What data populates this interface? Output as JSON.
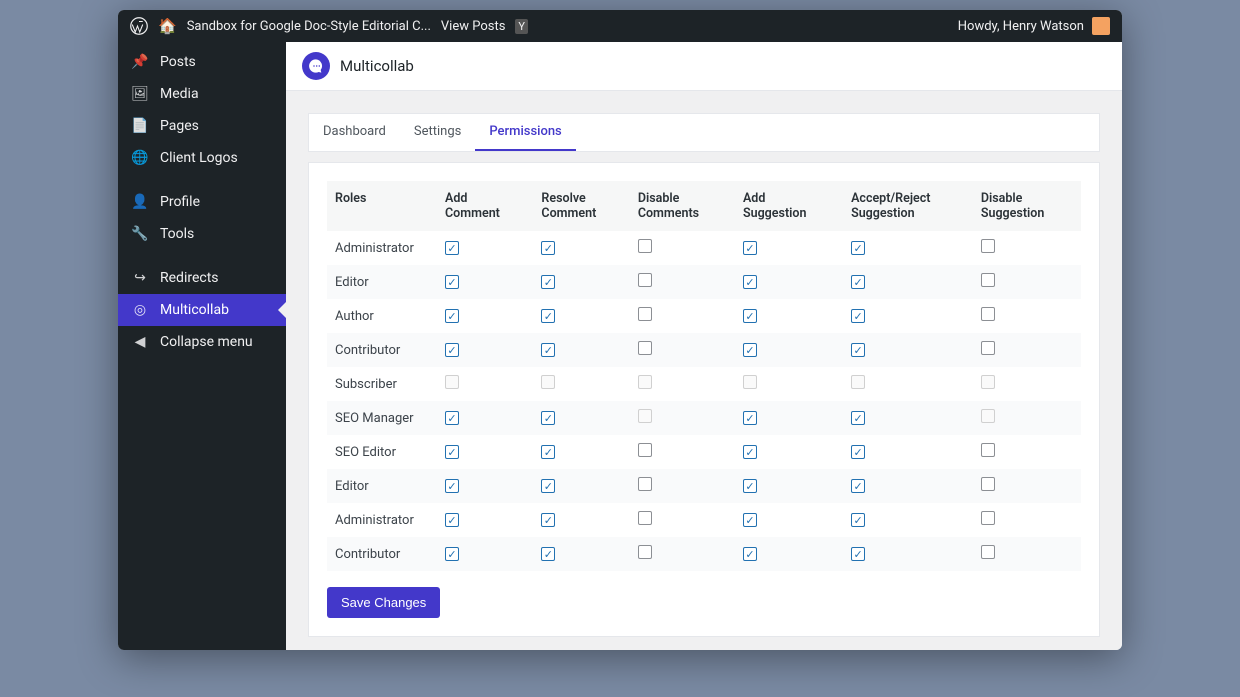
{
  "adminBar": {
    "siteName": "Sandbox for Google Doc-Style Editorial C...",
    "viewPosts": "View Posts",
    "howdy": "Howdy, Henry Watson"
  },
  "sidebar": {
    "items": [
      {
        "icon": "📌",
        "label": "Posts",
        "name": "sidebar-item-posts"
      },
      {
        "icon": "🖼",
        "label": "Media",
        "name": "sidebar-item-media"
      },
      {
        "icon": "📄",
        "label": "Pages",
        "name": "sidebar-item-pages"
      },
      {
        "icon": "🌐",
        "label": "Client Logos",
        "name": "sidebar-item-client-logos"
      }
    ],
    "items2": [
      {
        "icon": "👤",
        "label": "Profile",
        "name": "sidebar-item-profile"
      },
      {
        "icon": "🔧",
        "label": "Tools",
        "name": "sidebar-item-tools"
      }
    ],
    "items3": [
      {
        "icon": "↪",
        "label": "Redirects",
        "name": "sidebar-item-redirects"
      },
      {
        "icon": "◎",
        "label": "Multicollab",
        "name": "sidebar-item-multicollab",
        "active": true
      },
      {
        "icon": "◀",
        "label": "Collapse menu",
        "name": "sidebar-item-collapse"
      }
    ]
  },
  "page": {
    "brand": "Multicollab"
  },
  "tabs": [
    {
      "label": "Dashboard",
      "name": "tab-dashboard"
    },
    {
      "label": "Settings",
      "name": "tab-settings"
    },
    {
      "label": "Permissions",
      "name": "tab-permissions",
      "active": true
    }
  ],
  "table": {
    "columns": [
      "Roles",
      "Add Comment",
      "Resolve Comment",
      "Disable Comments",
      "Add Suggestion",
      "Accept/Reject Suggestion",
      "Disable Suggestion"
    ],
    "rows": [
      {
        "role": "Administrator",
        "cells": [
          "checked",
          "checked",
          "unchecked",
          "checked",
          "checked",
          "unchecked"
        ]
      },
      {
        "role": "Editor",
        "cells": [
          "checked",
          "checked",
          "unchecked",
          "checked",
          "checked",
          "unchecked"
        ]
      },
      {
        "role": "Author",
        "cells": [
          "checked",
          "checked",
          "unchecked",
          "checked",
          "checked",
          "unchecked"
        ]
      },
      {
        "role": "Contributor",
        "cells": [
          "checked",
          "checked",
          "unchecked",
          "checked",
          "checked",
          "unchecked"
        ]
      },
      {
        "role": "Subscriber",
        "cells": [
          "disabled",
          "disabled",
          "disabled",
          "disabled",
          "disabled",
          "disabled"
        ]
      },
      {
        "role": "SEO Manager",
        "cells": [
          "checked",
          "checked",
          "disabled",
          "checked",
          "checked",
          "disabled"
        ]
      },
      {
        "role": "SEO Editor",
        "cells": [
          "checked",
          "checked",
          "unchecked",
          "checked",
          "checked",
          "unchecked"
        ]
      },
      {
        "role": "Editor",
        "cells": [
          "checked",
          "checked",
          "unchecked",
          "checked",
          "checked",
          "unchecked"
        ]
      },
      {
        "role": "Administrator",
        "cells": [
          "checked",
          "checked",
          "unchecked",
          "checked",
          "checked",
          "unchecked"
        ]
      },
      {
        "role": "Contributor",
        "cells": [
          "checked",
          "checked",
          "unchecked",
          "checked",
          "checked",
          "unchecked"
        ]
      }
    ]
  },
  "actions": {
    "save": "Save Changes"
  }
}
